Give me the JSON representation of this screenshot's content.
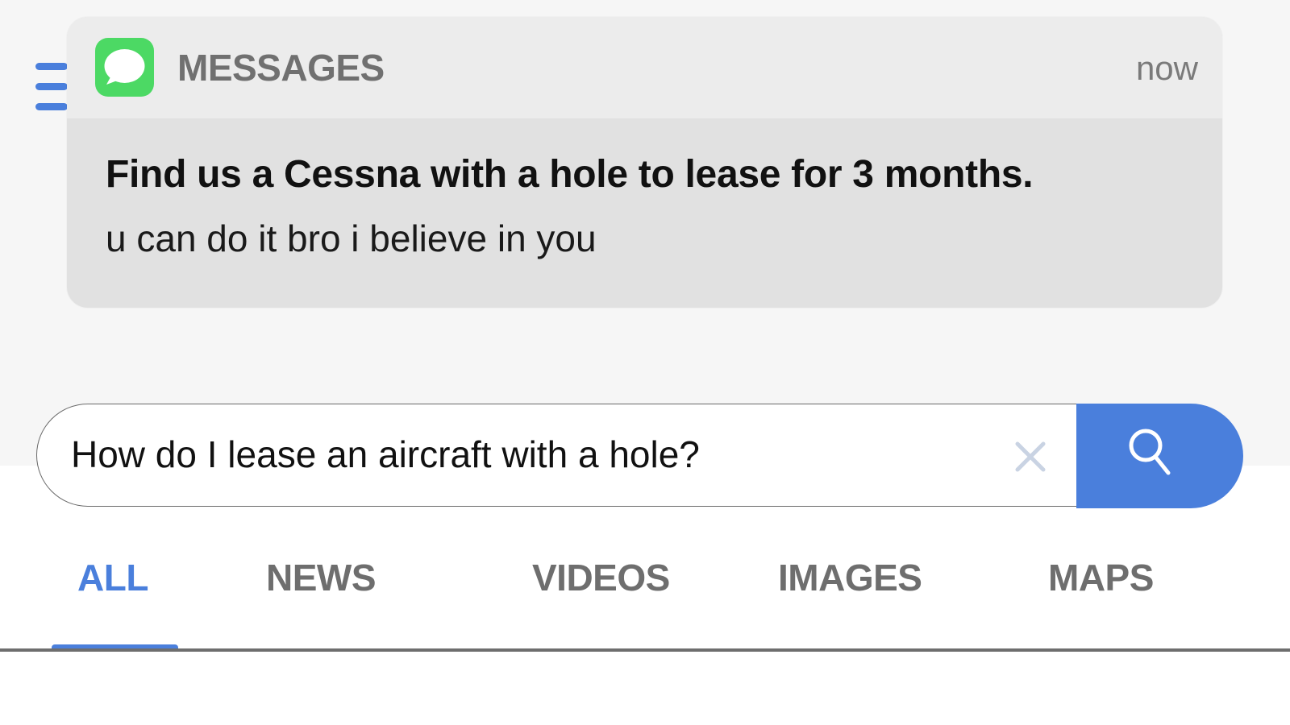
{
  "notification": {
    "app_name": "MESSAGES",
    "time": "now",
    "title": "Find us a Cessna with a hole to lease for 3 months.",
    "body": "u can do it bro i believe in you",
    "icon": "messages-bubble-icon"
  },
  "search": {
    "value": "How do I lease an aircraft with a hole?",
    "clear_icon": "close-icon",
    "submit_icon": "search-icon"
  },
  "menu_icon": "hamburger-menu-icon",
  "tabs": [
    {
      "label": "ALL",
      "active": true
    },
    {
      "label": "NEWS",
      "active": false
    },
    {
      "label": "VIDEOS",
      "active": false
    },
    {
      "label": "IMAGES",
      "active": false
    },
    {
      "label": "MAPS",
      "active": false
    }
  ],
  "colors": {
    "accent": "#4a7fdc",
    "messages_green": "#4cd964",
    "tab_inactive": "#6e6e6e"
  }
}
